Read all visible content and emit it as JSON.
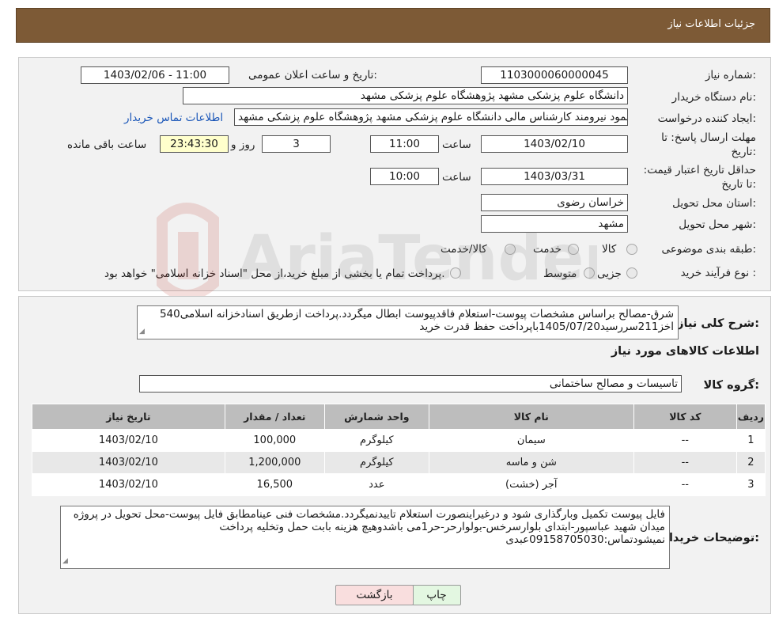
{
  "header": {
    "title": "جزئیات اطلاعات نیاز"
  },
  "form": {
    "need_number_label": "شماره نیاز:",
    "need_number": "1103000060000045",
    "announce_label": "تاریخ و ساعت اعلان عمومی:",
    "announce_value": "1403/02/06 - 11:00",
    "buyer_org_label": "نام دستگاه خریدار:",
    "buyer_org": "دانشگاه علوم پزشکی مشهد   پژوهشگاه علوم پزشکی مشهد",
    "requester_label": "ایجاد کننده درخواست:",
    "requester": "محمود نیرومند کارشناس مالی دانشگاه علوم پزشکی مشهد   پژوهشگاه علوم پزشکی مشهد",
    "contact_link": "اطلاعات تماس خریدار",
    "deadline_label": "مهلت ارسال پاسخ: تا تاریخ:",
    "deadline_date": "1403/02/10",
    "time_label": "ساعت",
    "deadline_time": "11:00",
    "days": "3",
    "days_label": "روز و",
    "remaining": "23:43:30",
    "remaining_label": "ساعت باقی مانده",
    "validity_label": "حداقل تاریخ اعتبار قیمت: تا تاریخ:",
    "validity_date": "1403/03/31",
    "validity_time_label": "ساعت",
    "validity_time": "10:00",
    "province_label": "استان محل تحویل:",
    "province": "خراسان رضوی",
    "city_label": "شهر محل تحویل:",
    "city": "مشهد",
    "category_label": "طبقه بندی موضوعی:",
    "category_options": [
      "کالا",
      "خدمت",
      "کالا/خدمت"
    ],
    "process_label": "نوع فرآیند خرید :",
    "process_options": [
      "جزیی",
      "متوسط"
    ],
    "process_note": "پرداخت تمام یا بخشی از مبلغ خرید،از محل \"اسناد خزانه اسلامی\" خواهد بود."
  },
  "details": {
    "summary_label": "شرح کلی نیاز:",
    "summary_text": "540شرق-مصالح براساس مشخصات پیوست-استعلام فاقدپیوست ابطال میگردد.پرداخت ازطریق اسنادخزانه اسلامی اخز211سررسید1405/07/20باپرداخت حفظ قدرت خرید",
    "goods_info_title": "اطلاعات کالاهای مورد نیاز",
    "goods_group_label": "گروه کالا:",
    "goods_group": "تاسیسات و مصالح ساختمانی",
    "table": {
      "headers": [
        "ردیف",
        "کد کالا",
        "نام کالا",
        "واحد شمارش",
        "تعداد / مقدار",
        "تاریخ نیاز"
      ],
      "rows": [
        [
          "1",
          "--",
          "سیمان",
          "کیلوگرم",
          "100,000",
          "1403/02/10"
        ],
        [
          "2",
          "--",
          "شن و ماسه",
          "کیلوگرم",
          "1,200,000",
          "1403/02/10"
        ],
        [
          "3",
          "--",
          "آجر (خشت)",
          "عدد",
          "16,500",
          "1403/02/10"
        ]
      ]
    },
    "buyer_notes_label": "توضیحات خریدار:",
    "buyer_notes": "فایل پیوست تکمیل وبارگذاری شود و درغیراینصورت استعلام تاییدنمیگردد.مشخصات فنی عینامطابق فایل پیوست-محل تحویل در پروژه میدان شهید عباسپور-ابتدای بلوارسرخس-بولوارحر-حر1می باشدوهیچ هزینه بابت حمل وتخلیه پرداخت نمیشودتماس:09158705030عبدی"
  },
  "buttons": {
    "print": "چاپ",
    "back": "بازگشت"
  },
  "watermark": {
    "text": "AriaTender.neT"
  },
  "colors": {
    "header_bg": "#7d5a36",
    "print_bg": "#e3f7e1",
    "back_bg": "#f9dede",
    "link": "#1a56b8"
  }
}
